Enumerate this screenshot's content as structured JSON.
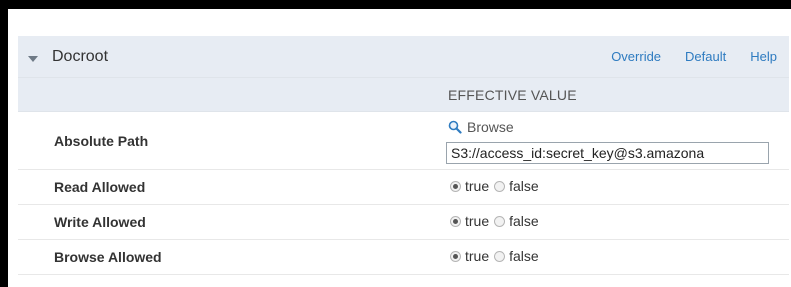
{
  "panel": {
    "title": "Docroot",
    "links": {
      "override": "Override",
      "default": "Default",
      "help": "Help"
    },
    "column_header": "EFFECTIVE VALUE"
  },
  "absolute_path": {
    "label": "Absolute Path",
    "browse_label": "Browse",
    "value": "S3://access_id:secret_key@s3.amazona"
  },
  "options": {
    "true_label": "true",
    "false_label": "false"
  },
  "read_allowed": {
    "label": "Read Allowed",
    "selected": "true"
  },
  "write_allowed": {
    "label": "Write Allowed",
    "selected": "true"
  },
  "browse_allowed": {
    "label": "Browse Allowed",
    "selected": "true"
  },
  "colors": {
    "header_bg": "#e7ecf3",
    "link": "#2e7bc0"
  },
  "icons": {
    "collapse": "triangle-down-icon",
    "browse": "magnifier-icon"
  }
}
